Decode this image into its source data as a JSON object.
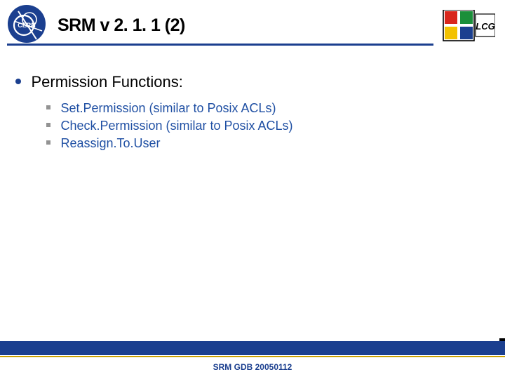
{
  "header": {
    "title": "SRM v 2. 1. 1 (2)",
    "cern_label": "CERN",
    "lcg_label": "LCG"
  },
  "content": {
    "heading": "Permission Functions:",
    "items": [
      "Set.Permission (similar to Posix ACLs)",
      "Check.Permission (similar to Posix ACLs)",
      "Reassign.To.User"
    ]
  },
  "footer": {
    "text": "SRM GDB 20050112"
  },
  "colors": {
    "accent": "#1b3f8f",
    "link": "#1f4fa3",
    "gold": "#c9a000"
  }
}
